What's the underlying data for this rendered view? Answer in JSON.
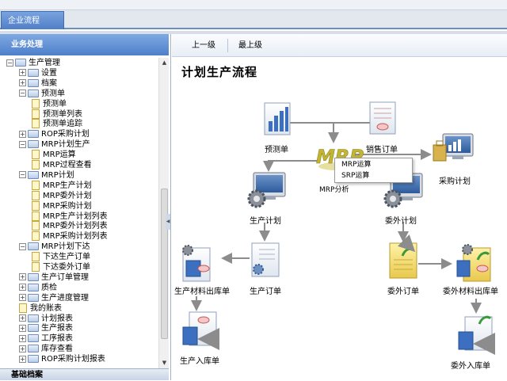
{
  "tabs": [
    {
      "label": "企业流程"
    }
  ],
  "sidebar": {
    "title": "业务处理",
    "footer": "基础档案",
    "tree": [
      {
        "label": "生产管理",
        "kind": "folder",
        "exp": "−",
        "level": 0
      },
      {
        "label": "设置",
        "kind": "folder",
        "exp": "+",
        "level": 1
      },
      {
        "label": "档案",
        "kind": "folder",
        "exp": "+",
        "level": 1
      },
      {
        "label": "预测单",
        "kind": "folder",
        "exp": "−",
        "level": 1
      },
      {
        "label": "预测单",
        "kind": "doc",
        "level": 2
      },
      {
        "label": "预测单列表",
        "kind": "doc",
        "level": 2
      },
      {
        "label": "预测单追踪",
        "kind": "doc",
        "level": 2
      },
      {
        "label": "ROP采购计划",
        "kind": "folder",
        "exp": "+",
        "level": 1
      },
      {
        "label": "MRP计划生产",
        "kind": "folder",
        "exp": "−",
        "level": 1
      },
      {
        "label": "MRP运算",
        "kind": "doc",
        "level": 2
      },
      {
        "label": "MRP过程查看",
        "kind": "doc",
        "level": 2
      },
      {
        "label": "MRP计划",
        "kind": "folder",
        "exp": "−",
        "level": 1
      },
      {
        "label": "MRP生产计划",
        "kind": "doc",
        "level": 2
      },
      {
        "label": "MRP委外计划",
        "kind": "doc",
        "level": 2
      },
      {
        "label": "MRP采购计划",
        "kind": "doc",
        "level": 2
      },
      {
        "label": "MRP生产计划列表",
        "kind": "doc",
        "level": 2
      },
      {
        "label": "MRP委外计划列表",
        "kind": "doc",
        "level": 2
      },
      {
        "label": "MRP采购计划列表",
        "kind": "doc",
        "level": 2
      },
      {
        "label": "MRP计划下达",
        "kind": "folder",
        "exp": "−",
        "level": 1
      },
      {
        "label": "下达生产订单",
        "kind": "doc",
        "level": 2
      },
      {
        "label": "下达委外订单",
        "kind": "doc",
        "level": 2
      },
      {
        "label": "生产订单管理",
        "kind": "folder",
        "exp": "+",
        "level": 1
      },
      {
        "label": "质检",
        "kind": "folder",
        "exp": "+",
        "level": 1
      },
      {
        "label": "生产进度管理",
        "kind": "folder",
        "exp": "+",
        "level": 1
      },
      {
        "label": "我的账表",
        "kind": "doc",
        "level": 1
      },
      {
        "label": "计划报表",
        "kind": "folder",
        "exp": "+",
        "level": 1
      },
      {
        "label": "生产报表",
        "kind": "folder",
        "exp": "+",
        "level": 1
      },
      {
        "label": "工序报表",
        "kind": "folder",
        "exp": "+",
        "level": 1
      },
      {
        "label": "库存查看",
        "kind": "folder",
        "exp": "+",
        "level": 1
      },
      {
        "label": "ROP采购计划报表",
        "kind": "folder",
        "exp": "+",
        "level": 1
      }
    ]
  },
  "toolbar": {
    "up_label": "上一级",
    "top_label": "最上级"
  },
  "page": {
    "title": "计划生产流程"
  },
  "flow": {
    "nodes": [
      {
        "id": "forecast",
        "label": "预测单",
        "icon": "bar-chart-icon"
      },
      {
        "id": "sales",
        "label": "销售订单",
        "icon": "document-stamp-icon"
      },
      {
        "id": "mrp",
        "label": "MRP分析",
        "icon": "mrp-logo-icon",
        "logo_text": "MRP"
      },
      {
        "id": "purchase",
        "label": "采购计划",
        "icon": "monitor-chart-icon"
      },
      {
        "id": "prodplan",
        "label": "生产计划",
        "icon": "gear-monitor-icon"
      },
      {
        "id": "outplan",
        "label": "委外计划",
        "icon": "gear-monitor-icon"
      },
      {
        "id": "prodorder",
        "label": "生产订单",
        "icon": "gear-document-icon"
      },
      {
        "id": "outorder",
        "label": "委外订单",
        "icon": "yellow-document-icon"
      },
      {
        "id": "matout",
        "label": "生产材料出库单",
        "icon": "warehouse-out-icon"
      },
      {
        "id": "outmat",
        "label": "委外材料出库单",
        "icon": "warehouse-out-icon"
      },
      {
        "id": "prodin",
        "label": "生产入库单",
        "icon": "warehouse-in-icon"
      },
      {
        "id": "outin",
        "label": "委外入库单",
        "icon": "warehouse-in-icon"
      }
    ],
    "popup": [
      "MRP运算",
      "SRP运算"
    ]
  }
}
